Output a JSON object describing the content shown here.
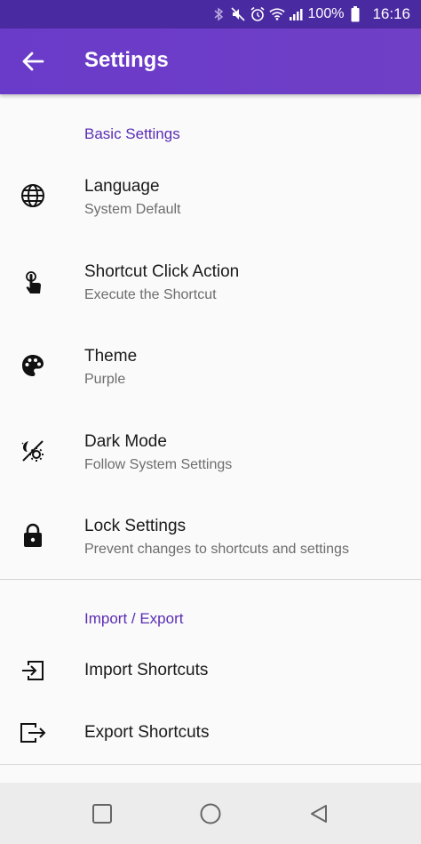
{
  "status_bar": {
    "battery": "100%",
    "time": "16:16",
    "icons": [
      "bluetooth-icon",
      "mute-icon",
      "alarm-icon",
      "wifi-icon",
      "signal-icon",
      "battery-icon"
    ]
  },
  "app_bar": {
    "title": "Settings",
    "back_icon": "arrow-back-icon",
    "background": "#6a3bc9"
  },
  "colors": {
    "accent": "#5a2db4",
    "status_bar": "#4a2aa0"
  },
  "sections": [
    {
      "header": "Basic Settings",
      "items": [
        {
          "icon": "globe-icon",
          "label": "Language",
          "subtitle": "System Default"
        },
        {
          "icon": "touch-icon",
          "label": "Shortcut Click Action",
          "subtitle": "Execute the Shortcut"
        },
        {
          "icon": "palette-icon",
          "label": "Theme",
          "subtitle": "Purple"
        },
        {
          "icon": "dark-mode-icon",
          "label": "Dark Mode",
          "subtitle": "Follow System Settings"
        },
        {
          "icon": "lock-icon",
          "label": "Lock Settings",
          "subtitle": "Prevent changes to shortcuts and settings"
        }
      ]
    },
    {
      "header": "Import / Export",
      "items": [
        {
          "icon": "import-icon",
          "label": "Import Shortcuts"
        },
        {
          "icon": "export-icon",
          "label": "Export Shortcuts"
        }
      ]
    }
  ],
  "nav_bar": {
    "buttons": [
      "recents-square-icon",
      "home-circle-icon",
      "back-triangle-icon"
    ]
  }
}
